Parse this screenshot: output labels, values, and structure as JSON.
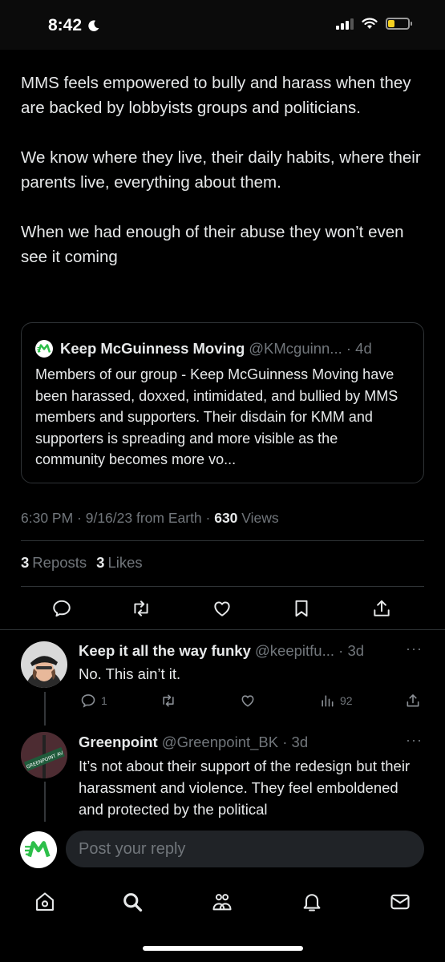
{
  "status_bar": {
    "time": "8:42",
    "battery_level": 0.35,
    "battery_color": "#f5d020"
  },
  "tweet": {
    "paragraphs": [
      "MMS feels empowered to bully and harass when they are backed by lobbyists groups and politicians.",
      "We know where they live, their daily habits, where their parents live, everything about them.",
      "When we had enough of their abuse they won’t even see it coming"
    ],
    "quote": {
      "name": "Keep McGuinness Moving",
      "handle": "@KMcguinn... · 4d",
      "text": "Members of our group - Keep McGuinness Moving have been harassed, doxxed, intimidated, and bullied by MMS members and supporters. Their disdain for KMM and supporters is spreading and more visible as the community becomes more vo..."
    },
    "meta": {
      "time_date": "6:30 PM · 9/16/23 from Earth · ",
      "views_count": "630",
      "views_label": " Views"
    },
    "stats": {
      "reposts_count": "3",
      "reposts_label": "Reposts",
      "likes_count": "3",
      "likes_label": "Likes"
    },
    "actions": [
      "reply-icon",
      "repost-icon",
      "like-icon",
      "bookmark-icon",
      "share-icon"
    ]
  },
  "replies": [
    {
      "name": "Keep it all the way funky",
      "handle": " @keepitfu... · 3d",
      "text": "No. This ain’t it.",
      "reply_count": "1",
      "views_count": "92"
    },
    {
      "name": "Greenpoint",
      "handle": " @Greenpoint_BK · 3d",
      "text": "It’s not about their support of the redesign but their harassment and violence. They feel emboldened and protected by the political",
      "avatar_sign_text": "GREENPOINT AV"
    }
  ],
  "more_label": "···",
  "composer": {
    "placeholder": "Post your reply"
  },
  "tabbar": [
    "home-icon",
    "search-icon",
    "communities-icon",
    "notifications-icon",
    "messages-icon"
  ],
  "colors": {
    "background": "#000000",
    "text": "#e7e9ea",
    "secondary": "#71767b",
    "border": "#2f3336",
    "brand_green": "#2dbf4a"
  }
}
